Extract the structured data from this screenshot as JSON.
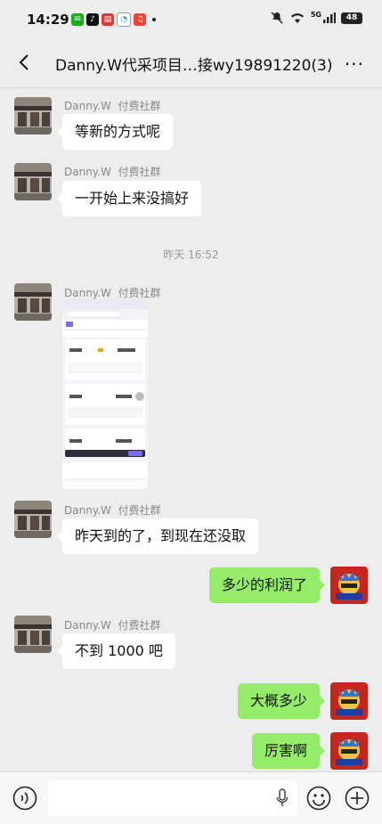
{
  "status_bar": {
    "time": "14:29",
    "battery": "48",
    "network": "5G"
  },
  "chat": {
    "title": "Danny.W代采项目…接wy19891220(3)",
    "messages": [
      {
        "sender": "Danny.W",
        "tag": "付费社群",
        "text": "等新的方式呢"
      },
      {
        "sender": "Danny.W",
        "tag": "付费社群",
        "text": "一开始上来没搞好"
      },
      {
        "timestamp": "昨天 16:52"
      },
      {
        "sender": "Danny.W",
        "tag": "付费社群",
        "image": "screenshot-thumbnail"
      },
      {
        "sender": "Danny.W",
        "tag": "付费社群",
        "text": "昨天到的了，到现在还没取"
      },
      {
        "self": true,
        "text": "多少的利润了"
      },
      {
        "sender": "Danny.W",
        "tag": "付费社群",
        "text": "不到 1000 吧"
      },
      {
        "self": true,
        "text": "大概多少"
      },
      {
        "self": true,
        "text": "厉害啊"
      }
    ]
  },
  "colors": {
    "background": "#ededed",
    "self_bubble": "#95ec69",
    "other_bubble": "#ffffff"
  }
}
